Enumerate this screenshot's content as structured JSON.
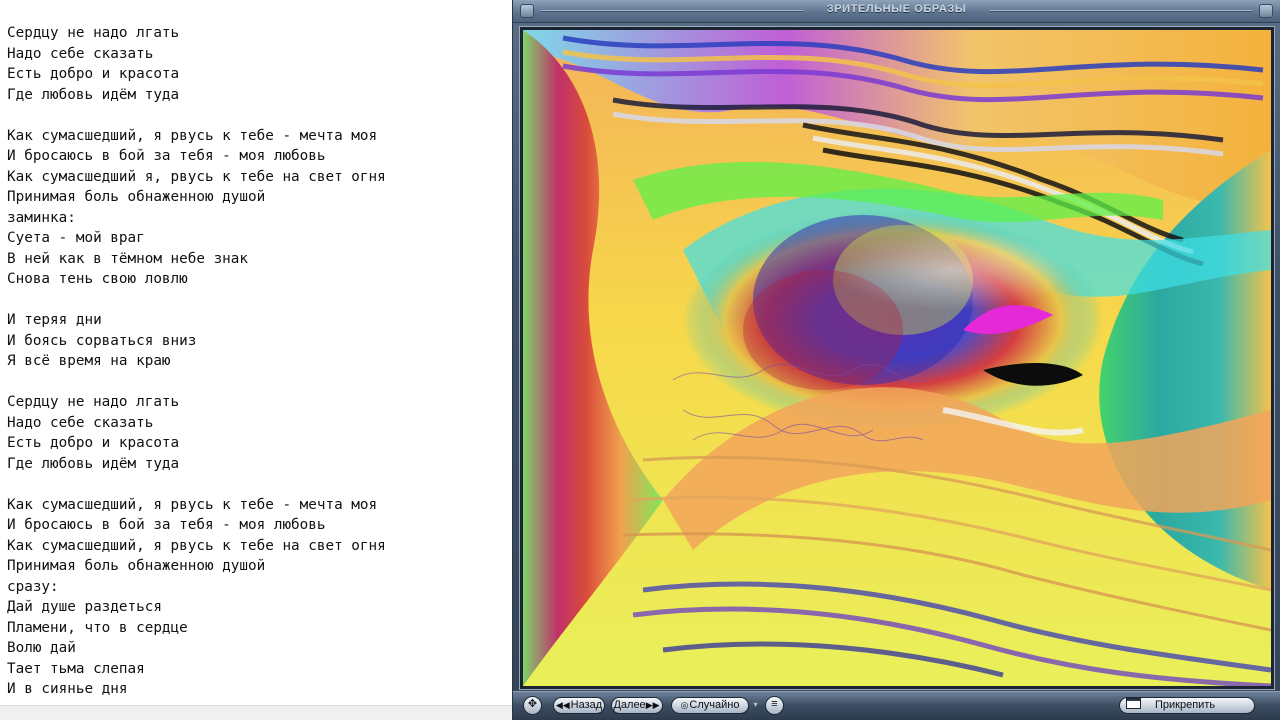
{
  "editor": {
    "lines": [
      "Сердцу не надо лгать",
      "Надо себе сказать",
      "Есть добро и красота",
      "Где любовь идём туда",
      "",
      "Как сумасшедший, я рвусь к тебе - мечта моя",
      "И бросаюсь в бой за тебя - моя любовь",
      "Как сумасшедший я, рвусь к тебе на свет огня",
      "Принимая боль обнаженною душой",
      "заминка:",
      "Суета - мой враг",
      "В ней как в тёмном небе знак",
      "Снова тень свою ловлю",
      "",
      "И теряя дни",
      "И боясь сорваться вниз",
      "Я всё время на краю",
      "",
      "Сердцу не надо лгать",
      "Надо себе сказать",
      "Есть добро и красота",
      "Где любовь идём туда",
      "",
      "Как сумасшедший, я рвусь к тебе - мечта моя",
      "И бросаюсь в бой за тебя - моя любовь",
      "Как сумасшедший, я рвусь к тебе на свет огня",
      "Принимая боль обнаженною душой",
      "сразу:",
      "Дай душе раздеться",
      "Пламени, что в сердце",
      "Волю дай",
      "Тает тьма слепая",
      "И в сиянье дня"
    ]
  },
  "player": {
    "title": "ЗРИТЕЛЬНЫЕ ОБРАЗЫ",
    "controls": {
      "move_icon": "move-arrows-icon",
      "back_label": "Назад",
      "back_glyph": "◀◀",
      "next_label": "Далее",
      "next_glyph": "▶▶",
      "random_label": "Случайно",
      "random_glyph": "◎",
      "random_dropdown_glyph": "▾",
      "list_glyph": "≡",
      "pin_label": "Прикрепить"
    },
    "colors": {
      "chrome_dark": "#34455a",
      "chrome_light": "#8ea2b9"
    }
  }
}
